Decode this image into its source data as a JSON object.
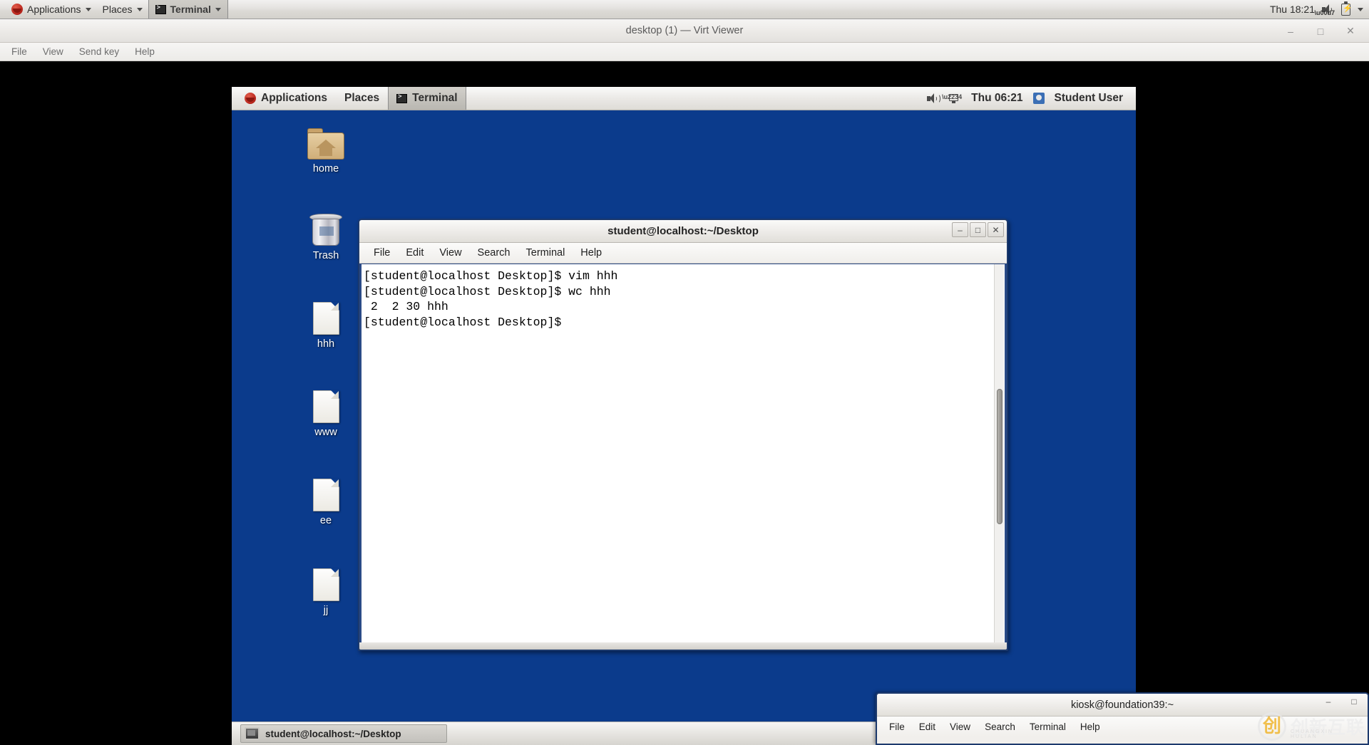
{
  "host_panel": {
    "applications_label": "Applications",
    "places_label": "Places",
    "terminal_task_label": "Terminal",
    "clock": "Thu 18:21",
    "icons": {
      "redhat": "redhat-logo-icon",
      "speaker_muted": "speaker-muted-icon",
      "battery": "battery-charging-icon",
      "dropdown": "chevron-down-icon"
    }
  },
  "virt_viewer": {
    "title": "desktop (1) — Virt Viewer",
    "menu": [
      "File",
      "View",
      "Send key",
      "Help"
    ],
    "window_buttons": {
      "minimize": "–",
      "maximize": "□",
      "close": "✕"
    }
  },
  "guest_panel": {
    "applications_label": "Applications",
    "places_label": "Places",
    "terminal_task_label": "Terminal",
    "clock": "Thu 06:21",
    "user_label": "Student User",
    "icons": {
      "redhat": "redhat-logo-icon",
      "speaker": "speaker-icon",
      "network": "network-icon",
      "user": "user-icon"
    }
  },
  "desktop_icons": [
    {
      "label": "home",
      "type": "folder",
      "name": "desktop-icon-home"
    },
    {
      "label": "Trash",
      "type": "trash",
      "name": "desktop-icon-trash"
    },
    {
      "label": "hhh",
      "type": "file",
      "name": "desktop-icon-hhh"
    },
    {
      "label": "www",
      "type": "file",
      "name": "desktop-icon-www"
    },
    {
      "label": "ee",
      "type": "file",
      "name": "desktop-icon-ee"
    },
    {
      "label": "jj",
      "type": "file",
      "name": "desktop-icon-jj"
    }
  ],
  "guest_terminal": {
    "title": "student@localhost:~/Desktop",
    "menu": [
      "File",
      "Edit",
      "View",
      "Search",
      "Terminal",
      "Help"
    ],
    "window_buttons": {
      "minimize": "–",
      "maximize": "□",
      "close": "✕"
    },
    "lines": [
      "[student@localhost Desktop]$ vim hhh",
      "[student@localhost Desktop]$ wc hhh",
      " 2  2 30 hhh",
      "[student@localhost Desktop]$"
    ]
  },
  "guest_taskbar": {
    "task_label": "student@localhost:~/Desktop"
  },
  "kiosk_terminal": {
    "title": "kiosk@foundation39:~",
    "menu": [
      "File",
      "Edit",
      "View",
      "Search",
      "Terminal",
      "Help"
    ],
    "window_buttons": {
      "minimize": "–",
      "maximize": "□"
    }
  },
  "watermark": {
    "mark": "创",
    "text": "创新互联",
    "subtext": "CHUANGXIN HULIAN"
  },
  "colors": {
    "desktop_blue": "#0b3b8c",
    "panel_grey": "#e4e2df",
    "terminal_bg": "#ffffff",
    "frame_blue": "#1d3a6d"
  }
}
